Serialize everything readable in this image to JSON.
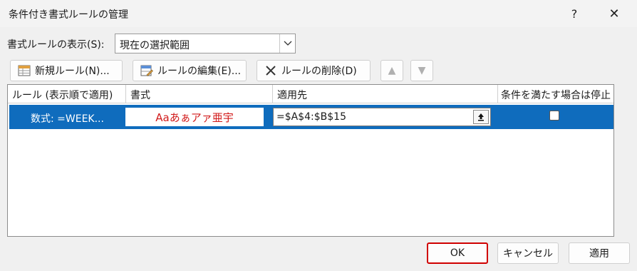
{
  "window": {
    "title": "条件付き書式ルールの管理",
    "help": "?",
    "close": "✕"
  },
  "show_rules": {
    "label": "書式ルールの表示(S):",
    "selected": "現在の選択範囲"
  },
  "toolbar": {
    "new_rule": "新規ルール(N)...",
    "edit_rule": "ルールの編集(E)...",
    "delete_rule": "ルールの削除(D)",
    "move_up": "▲",
    "move_down": "▼"
  },
  "table": {
    "columns": [
      "ルール (表示順で適用)",
      "書式",
      "適用先",
      "条件を満たす場合は停止"
    ],
    "rows": [
      {
        "rule": "数式: =WEEK...",
        "format_preview": "Aaあぁアァ亜宇",
        "applies_to": "=$A$4:$B$15",
        "stop_if_true": false
      }
    ]
  },
  "footer": {
    "ok": "OK",
    "cancel": "キャンセル",
    "apply": "適用"
  },
  "colors": {
    "selection": "#0f6cbd",
    "format_text": "#d11a1a",
    "ok_highlight": "#d00000"
  }
}
